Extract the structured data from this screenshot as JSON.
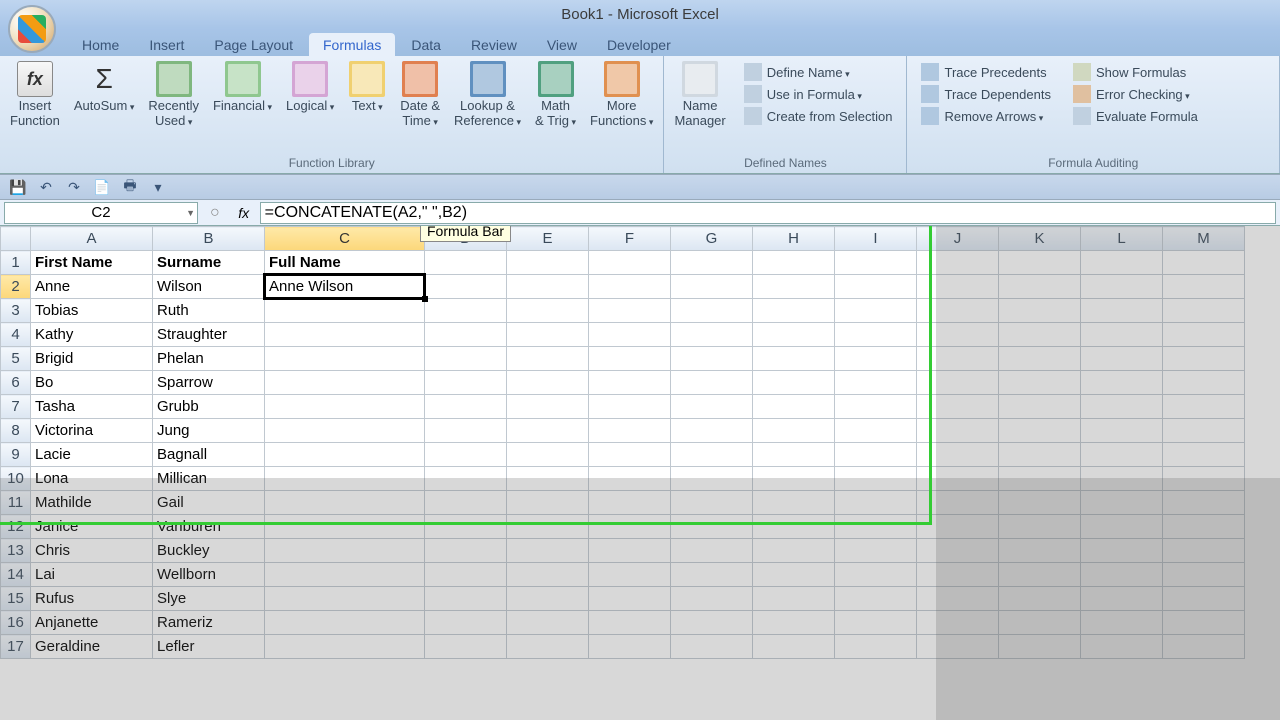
{
  "title": "Book1 - Microsoft Excel",
  "tabs": [
    "Home",
    "Insert",
    "Page Layout",
    "Formulas",
    "Data",
    "Review",
    "View",
    "Developer"
  ],
  "active_tab": "Formulas",
  "ribbon": {
    "function_library": {
      "label": "Function Library",
      "insert_function": "Insert\nFunction",
      "autosum": "AutoSum",
      "recently_used": "Recently\nUsed",
      "financial": "Financial",
      "logical": "Logical",
      "text": "Text",
      "date_time": "Date &\nTime",
      "lookup_reference": "Lookup &\nReference",
      "math_trig": "Math\n& Trig",
      "more_functions": "More\nFunctions"
    },
    "defined_names": {
      "label": "Defined Names",
      "name_manager": "Name\nManager",
      "define_name": "Define Name",
      "use_in_formula": "Use in Formula",
      "create_from_selection": "Create from Selection"
    },
    "formula_auditing": {
      "label": "Formula Auditing",
      "trace_precedents": "Trace Precedents",
      "trace_dependents": "Trace Dependents",
      "remove_arrows": "Remove Arrows",
      "show_formulas": "Show Formulas",
      "error_checking": "Error Checking",
      "evaluate_formula": "Evaluate Formula"
    }
  },
  "namebox": "C2",
  "formula": "=CONCATENATE(A2,\" \",B2)",
  "tooltip": "Formula Bar",
  "columns": [
    "A",
    "B",
    "C",
    "D",
    "E",
    "F",
    "G",
    "H",
    "I"
  ],
  "right_columns": [
    "J",
    "K",
    "L",
    "M"
  ],
  "headers": {
    "A": "First Name",
    "B": "Surname",
    "C": "Full Name"
  },
  "rows": [
    {
      "r": 1,
      "A": "First Name",
      "B": "Surname",
      "C": "Full Name"
    },
    {
      "r": 2,
      "A": "Anne",
      "B": "Wilson",
      "C": "Anne Wilson"
    },
    {
      "r": 3,
      "A": "Tobias",
      "B": "Ruth",
      "C": ""
    },
    {
      "r": 4,
      "A": "Kathy",
      "B": "Straughter",
      "C": ""
    },
    {
      "r": 5,
      "A": "Brigid",
      "B": "Phelan",
      "C": ""
    },
    {
      "r": 6,
      "A": "Bo",
      "B": "Sparrow",
      "C": ""
    },
    {
      "r": 7,
      "A": "Tasha",
      "B": "Grubb",
      "C": ""
    },
    {
      "r": 8,
      "A": "Victorina",
      "B": "Jung",
      "C": ""
    },
    {
      "r": 9,
      "A": "Lacie",
      "B": "Bagnall",
      "C": ""
    },
    {
      "r": 10,
      "A": "Lona",
      "B": "Millican",
      "C": ""
    },
    {
      "r": 11,
      "A": "Mathilde",
      "B": "Gail",
      "C": ""
    },
    {
      "r": 12,
      "A": "Janice",
      "B": "Vanburen",
      "C": ""
    },
    {
      "r": 13,
      "A": "Chris",
      "B": "Buckley",
      "C": ""
    },
    {
      "r": 14,
      "A": "Lai",
      "B": "Wellborn",
      "C": ""
    },
    {
      "r": 15,
      "A": "Rufus",
      "B": "Slye",
      "C": ""
    },
    {
      "r": 16,
      "A": "Anjanette",
      "B": "Rameriz",
      "C": ""
    },
    {
      "r": 17,
      "A": "Geraldine",
      "B": "Lefler",
      "C": ""
    }
  ],
  "active_cell": "C2",
  "colors": {
    "green_border": "#33cc33",
    "highlight": "#ffff66"
  }
}
